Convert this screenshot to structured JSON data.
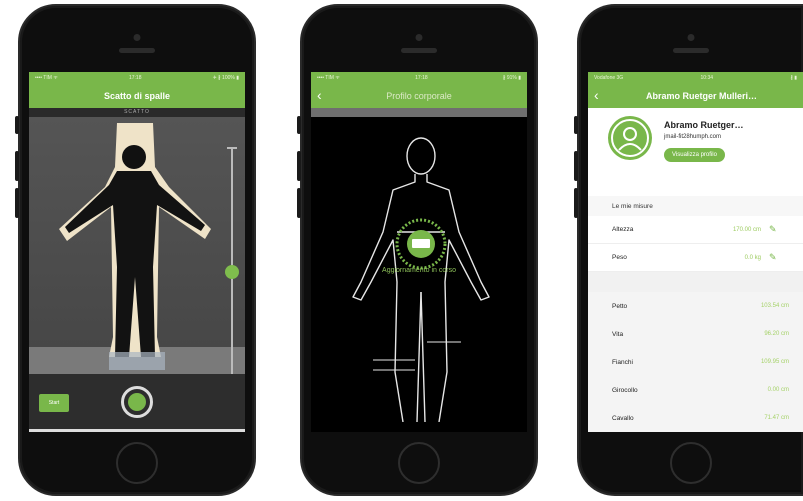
{
  "phone1": {
    "status_left": "•••• TIM ᯤ",
    "status_center": "17:18",
    "status_right": "✈ ∦ 100% ▮",
    "title": "Scatto di spalle",
    "subtitle": "SCATTO",
    "small_button": "Start"
  },
  "phone2": {
    "status_left": "•••• TIM ᯤ",
    "status_center": "17:18",
    "status_right": "∦ 91% ▮",
    "title": "Profilo corporale",
    "caption": "Aggiornamento in corso"
  },
  "phone3": {
    "status_left": "Vodafone 3G",
    "status_center": "10:34",
    "status_right": "∦ ▮",
    "title": "Abramo Ruetger Mulleri…",
    "name": "Abramo Ruetger…",
    "email": "jmail-fit28humph.com",
    "view_profile": "Visualizza profilo",
    "section_label": "Le mie misure",
    "editable": [
      {
        "label": "Altezza",
        "value": "170.00 cm"
      },
      {
        "label": "Peso",
        "value": "0.0 kg"
      }
    ],
    "measures": [
      {
        "label": "Petto",
        "value": "103.54 cm"
      },
      {
        "label": "Vita",
        "value": "96.20 cm"
      },
      {
        "label": "Fianchi",
        "value": "109.95 cm"
      },
      {
        "label": "Girocollo",
        "value": "0.00 cm"
      },
      {
        "label": "Cavallo",
        "value": "71.47 cm"
      }
    ]
  },
  "colors": {
    "accent": "#79b74a",
    "dark": "#0e0e0e"
  },
  "icons": [
    "back-icon",
    "pencil-icon",
    "avatar-icon",
    "body-outline-icon",
    "sync-icon"
  ]
}
